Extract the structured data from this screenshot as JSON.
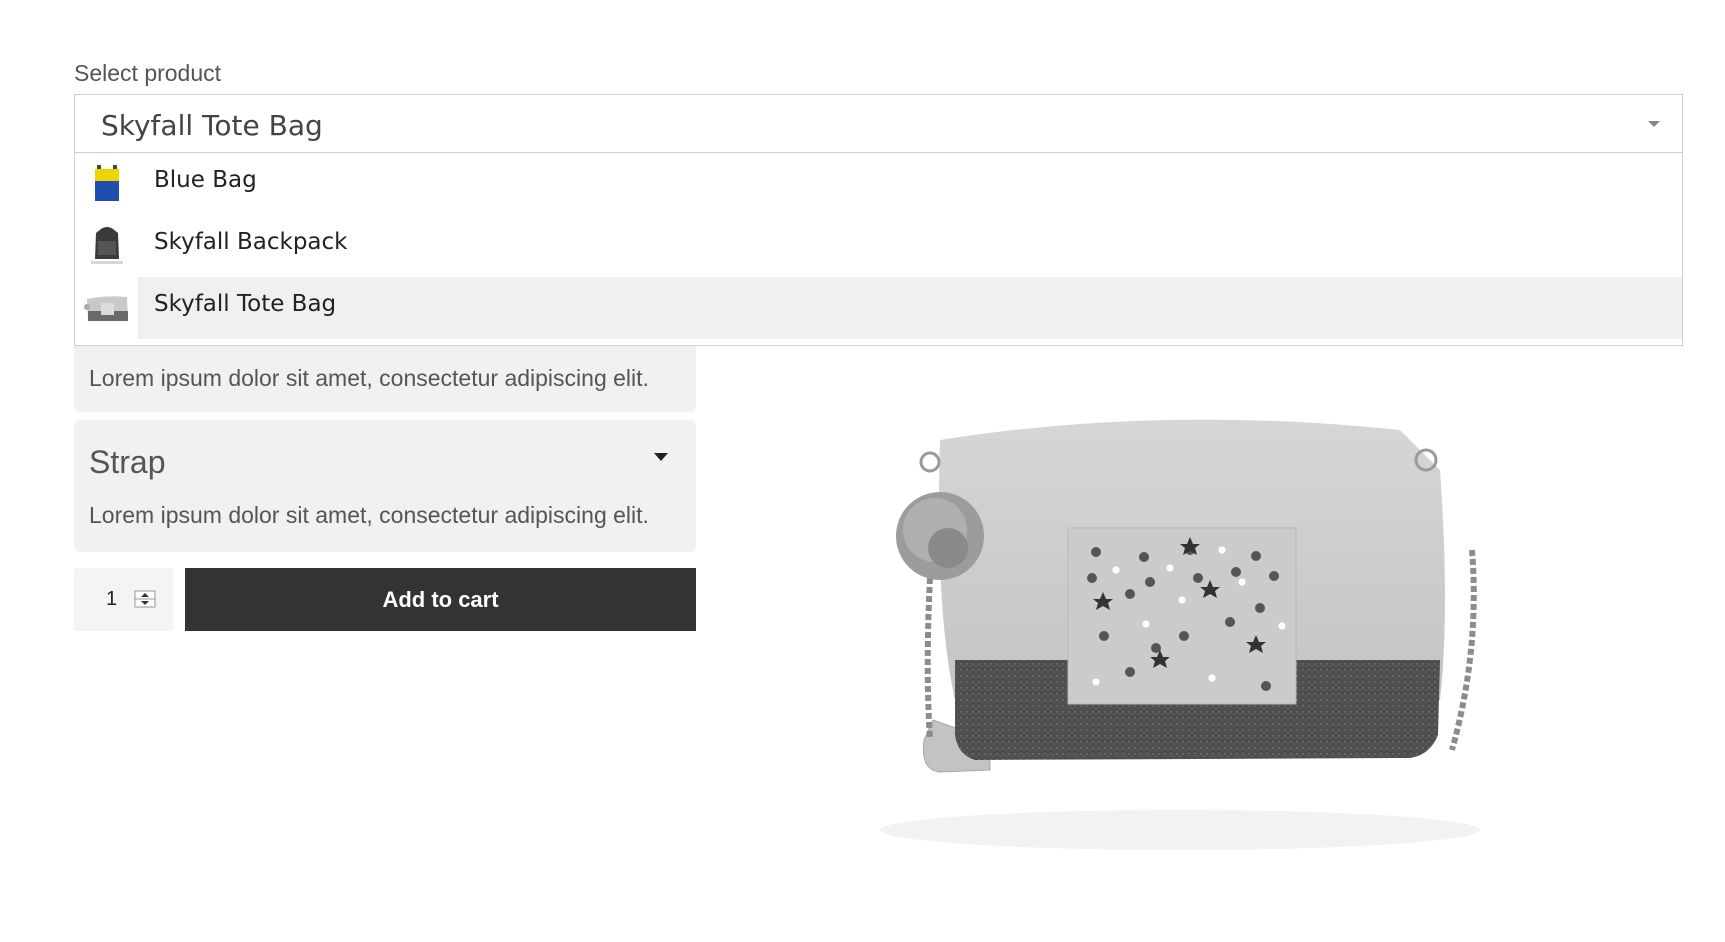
{
  "select": {
    "label": "Select product",
    "value": "Skyfall Tote Bag"
  },
  "options": [
    {
      "label": "Blue Bag",
      "icon": "blue-bag-thumbnail",
      "selected": false
    },
    {
      "label": "Skyfall Backpack",
      "icon": "backpack-thumbnail",
      "selected": false
    },
    {
      "label": "Skyfall Tote Bag",
      "icon": "tote-bag-thumbnail",
      "selected": true
    }
  ],
  "panels": [
    {
      "title": "",
      "description": "Lorem ipsum dolor sit amet, consectetur adipiscing elit."
    },
    {
      "title": "Strap",
      "description": "Lorem ipsum dolor sit amet, consectetur adipiscing elit."
    }
  ],
  "cart": {
    "quantity": "1",
    "button_label": "Add to cart"
  },
  "colors": {
    "button_bg": "#333333",
    "panel_bg": "#f1f1f1",
    "selected_option_bg": "#f0f0f0"
  }
}
